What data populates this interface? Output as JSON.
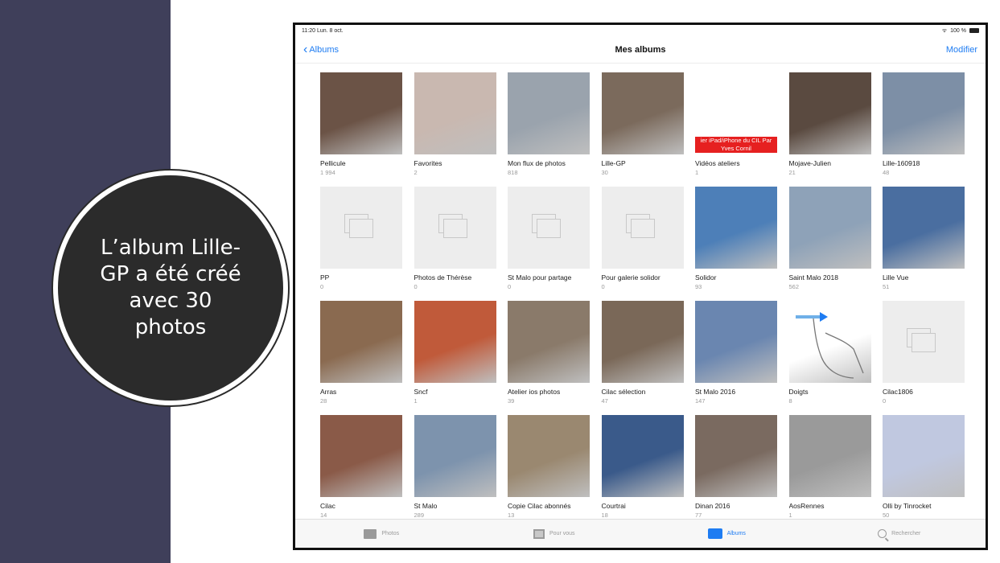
{
  "callout": {
    "text": "L’album Lille-GP a été créé avec 30 photos"
  },
  "status": {
    "time": "11:20",
    "date": "Lun. 8 oct.",
    "battery": "100 %"
  },
  "nav": {
    "back_label": "Albums",
    "title": "Mes albums",
    "edit_label": "Modifier"
  },
  "albums": [
    {
      "name": "Pellicule",
      "count": "1 994",
      "color": "#6b5346"
    },
    {
      "name": "Favorites",
      "count": "2",
      "color": "#c9b8b0"
    },
    {
      "name": "Mon flux de photos",
      "count": "818",
      "color": "#9aa3ad"
    },
    {
      "name": "Lille-GP",
      "count": "30",
      "color": "#7b6a5c"
    },
    {
      "name": "Vidéos ateliers",
      "count": "1",
      "color": "#ffffff",
      "banner": "ier iPad/iPhone du CIL Par Yves Cornil"
    },
    {
      "name": "Mojave-Julien",
      "count": "21",
      "color": "#5a4a40"
    },
    {
      "name": "Lille-160918",
      "count": "48",
      "color": "#7d8fa6"
    },
    {
      "name": "PP",
      "count": "0",
      "empty": true
    },
    {
      "name": "Photos de Thérèse",
      "count": "0",
      "empty": true
    },
    {
      "name": "St Malo pour partage",
      "count": "0",
      "empty": true
    },
    {
      "name": "Pour galerie solidor",
      "count": "0",
      "empty": true
    },
    {
      "name": "Solidor",
      "count": "93",
      "color": "#4d7fb8"
    },
    {
      "name": "Saint Malo 2018",
      "count": "562",
      "color": "#8ea2b8"
    },
    {
      "name": "Lille Vue",
      "count": "51",
      "color": "#4a6ea0"
    },
    {
      "name": "Arras",
      "count": "28",
      "color": "#8a6a50"
    },
    {
      "name": "Sncf",
      "count": "1",
      "color": "#c05a3a"
    },
    {
      "name": "Atelier ios photos",
      "count": "39",
      "color": "#8a7a6a"
    },
    {
      "name": "Cilac sélection",
      "count": "47",
      "color": "#7a6858"
    },
    {
      "name": "St Malo 2016",
      "count": "147",
      "color": "#6a86b0"
    },
    {
      "name": "Doigts",
      "count": "8",
      "color": "#ffffff",
      "gesture": true
    },
    {
      "name": "Cilac1806",
      "count": "0",
      "empty": true
    },
    {
      "name": "Cilac",
      "count": "14",
      "color": "#8a5a48"
    },
    {
      "name": "St Malo",
      "count": "289",
      "color": "#7d93ad"
    },
    {
      "name": "Copie Cilac abonnés",
      "count": "13",
      "color": "#9a8870"
    },
    {
      "name": "Courtrai",
      "count": "18",
      "color": "#3a5a8a"
    },
    {
      "name": "Dinan 2016",
      "count": "77",
      "color": "#7a6a60"
    },
    {
      "name": "AosRennes",
      "count": "1",
      "color": "#9a9a9a"
    },
    {
      "name": "Olli by Tinrocket",
      "count": "50",
      "color": "#c0c8e0"
    }
  ],
  "tabs": [
    {
      "label": "Photos",
      "icon": "photos-icon",
      "active": false
    },
    {
      "label": "Pour vous",
      "icon": "for-you-icon",
      "active": false
    },
    {
      "label": "Albums",
      "icon": "albums-icon",
      "active": true
    },
    {
      "label": "Rechercher",
      "icon": "search-icon",
      "active": false
    }
  ]
}
